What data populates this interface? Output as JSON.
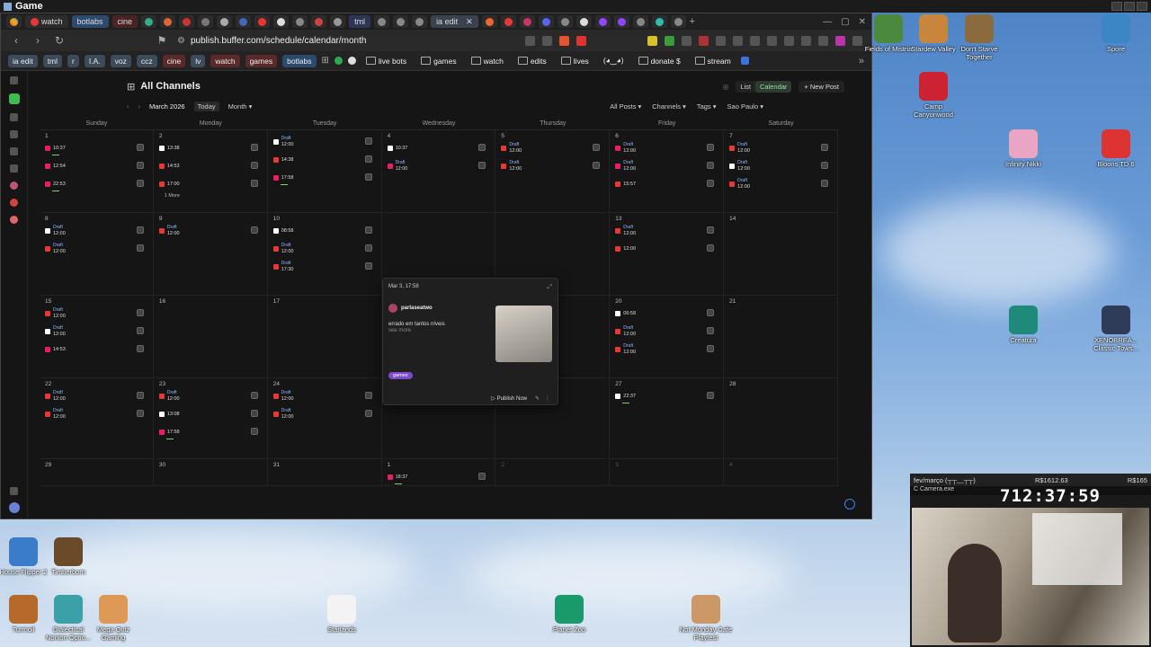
{
  "os": {
    "window_title": "Game"
  },
  "browser": {
    "tabs": [
      {
        "label": "",
        "color": "#e53935"
      },
      {
        "label": "watch",
        "color": "#e53935"
      },
      {
        "label": "botlabs",
        "color": "#2b7bd8"
      },
      {
        "label": "cine",
        "color": "#e53935"
      },
      {
        "label": "tml",
        "color": "#4c5bd4"
      },
      {
        "label": "ia edit",
        "color": "#888",
        "active": true
      }
    ],
    "url": "publish.buffer.com/schedule/calendar/month",
    "bookmarks": [
      {
        "label": "ia edit",
        "kind": "pill"
      },
      {
        "label": "tml",
        "kind": "pill"
      },
      {
        "label": "r",
        "kind": "pill"
      },
      {
        "label": "I.A.",
        "kind": "pill"
      },
      {
        "label": "voz",
        "kind": "pill"
      },
      {
        "label": "ccz",
        "kind": "pill"
      },
      {
        "label": "cine",
        "kind": "pill"
      },
      {
        "label": "lv",
        "kind": "pill"
      },
      {
        "label": "watch",
        "kind": "pill"
      },
      {
        "label": "games",
        "kind": "pill"
      },
      {
        "label": "botlabs",
        "kind": "pill"
      },
      {
        "label": "live bots",
        "kind": "folder"
      },
      {
        "label": "games",
        "kind": "folder"
      },
      {
        "label": "watch",
        "kind": "folder"
      },
      {
        "label": "edits",
        "kind": "folder"
      },
      {
        "label": "lives",
        "kind": "folder"
      },
      {
        "label": "(◕‿◕)",
        "kind": "plain"
      },
      {
        "label": "donate $",
        "kind": "folder"
      },
      {
        "label": "stream",
        "kind": "folder"
      }
    ]
  },
  "calendar": {
    "title": "All Channels",
    "month_label": "March 2026",
    "today_label": "Today",
    "view_label": "Month",
    "list_label": "List",
    "calendar_label": "Calendar",
    "new_post_label": "New Post",
    "filters": [
      "All Posts",
      "Channels",
      "Tags",
      "Sao Paulo"
    ],
    "weekdays": [
      "Sunday",
      "Monday",
      "Tuesday",
      "Wednesday",
      "Thursday",
      "Friday",
      "Saturday"
    ],
    "days": [
      {
        "n": "1",
        "posts": [
          {
            "t": "10:37",
            "c": "#e91e63",
            "bar": true
          },
          {
            "t": "12:54",
            "c": "#e91e63"
          },
          {
            "t": "22:53",
            "c": "#e91e63",
            "bar": true
          }
        ]
      },
      {
        "n": "2",
        "posts": [
          {
            "t": "13:38",
            "c": "#fff"
          },
          {
            "t": "14:53",
            "c": "#e53935"
          },
          {
            "t": "17:00",
            "c": "#e53935"
          }
        ],
        "more": "1 More"
      },
      {
        "n": "",
        "posts": [
          {
            "t": "12:00",
            "c": "#fff",
            "draft": true
          },
          {
            "t": "14:38",
            "c": "#e53935"
          },
          {
            "t": "17:58",
            "c": "#e91e63",
            "bar": true
          }
        ]
      },
      {
        "n": "4",
        "posts": [
          {
            "t": "10:37",
            "c": "#fff"
          },
          {
            "t": "12:00",
            "c": "#e91e63",
            "draft": true
          }
        ]
      },
      {
        "n": "5",
        "posts": [
          {
            "t": "12:00",
            "c": "#e53935",
            "draft": true
          },
          {
            "t": "12:00",
            "c": "#e53935",
            "draft": true
          }
        ]
      },
      {
        "n": "6",
        "posts": [
          {
            "t": "12:00",
            "c": "#e91e63",
            "draft": true
          },
          {
            "t": "12:00",
            "c": "#e91e63",
            "draft": true
          },
          {
            "t": "15:57",
            "c": "#e53935"
          }
        ]
      },
      {
        "n": "7",
        "posts": [
          {
            "t": "12:00",
            "c": "#e53935",
            "draft": true
          },
          {
            "t": "12:00",
            "c": "#fff",
            "draft": true
          },
          {
            "t": "12:00",
            "c": "#e53935",
            "draft": true
          }
        ]
      },
      {
        "n": "8",
        "posts": [
          {
            "t": "12:00",
            "c": "#fff",
            "draft": true
          },
          {
            "t": "12:00",
            "c": "#e53935",
            "draft": true
          }
        ]
      },
      {
        "n": "9",
        "posts": [
          {
            "t": "12:00",
            "c": "#e53935",
            "draft": true
          }
        ]
      },
      {
        "n": "10",
        "posts": [
          {
            "t": "08:58",
            "c": "#fff"
          },
          {
            "t": "12:00",
            "c": "#e53935",
            "draft": true
          },
          {
            "t": "17:30",
            "c": "#e53935",
            "draft": true
          }
        ]
      },
      {
        "n": "",
        "posts": []
      },
      {
        "n": "",
        "posts": []
      },
      {
        "n": "13",
        "posts": [
          {
            "t": "12:00",
            "c": "#e53935",
            "draft": true
          },
          {
            "t": "12:00",
            "c": "#e53935"
          }
        ]
      },
      {
        "n": "14",
        "posts": []
      },
      {
        "n": "15",
        "posts": [
          {
            "t": "12:00",
            "c": "#e53935",
            "draft": true
          },
          {
            "t": "12:00",
            "c": "#fff",
            "draft": true
          },
          {
            "t": "14:53",
            "c": "#e91e63"
          }
        ]
      },
      {
        "n": "16",
        "posts": []
      },
      {
        "n": "17",
        "posts": []
      },
      {
        "n": "",
        "posts": []
      },
      {
        "n": "",
        "posts": []
      },
      {
        "n": "20",
        "posts": [
          {
            "t": "06:58",
            "c": "#fff"
          },
          {
            "t": "12:00",
            "c": "#e53935",
            "draft": true
          },
          {
            "t": "12:00",
            "c": "#e53935",
            "draft": true
          }
        ]
      },
      {
        "n": "21",
        "posts": []
      },
      {
        "n": "22",
        "posts": [
          {
            "t": "12:00",
            "c": "#e53935",
            "draft": true
          },
          {
            "t": "12:00",
            "c": "#e53935",
            "draft": true
          }
        ]
      },
      {
        "n": "23",
        "posts": [
          {
            "t": "12:00",
            "c": "#e53935",
            "draft": true
          },
          {
            "t": "13:08",
            "c": "#fff"
          },
          {
            "t": "17:58",
            "c": "#e91e63",
            "bar": true
          }
        ]
      },
      {
        "n": "24",
        "posts": [
          {
            "t": "12:00",
            "c": "#e53935",
            "draft": true
          },
          {
            "t": "12:00",
            "c": "#e53935",
            "draft": true
          }
        ]
      },
      {
        "n": "25",
        "posts": [
          {
            "t": "12:00",
            "c": "#e91e63",
            "draft": true
          }
        ]
      },
      {
        "n": "26",
        "posts": []
      },
      {
        "n": "27",
        "posts": [
          {
            "t": "22:37",
            "c": "#fff",
            "bar": true
          }
        ]
      },
      {
        "n": "28",
        "posts": []
      },
      {
        "n": "29",
        "posts": []
      },
      {
        "n": "30",
        "posts": []
      },
      {
        "n": "31",
        "posts": []
      },
      {
        "n": "1",
        "posts": [
          {
            "t": "18:37",
            "c": "#e91e63",
            "bar": true
          }
        ]
      },
      {
        "n": "2",
        "dim": true,
        "posts": []
      },
      {
        "n": "3",
        "dim": true,
        "posts": []
      },
      {
        "n": "4",
        "dim": true,
        "posts": []
      }
    ],
    "popover": {
      "datetime": "Mar 3, 17:58",
      "account": "parlaseatwo",
      "text": "errado em tantos níveis",
      "see_more": "see more",
      "tag": "games",
      "publish_label": "Publish Now"
    }
  },
  "desktop": {
    "icons": [
      {
        "label": "Fields of Mistria",
        "color": "#4b8a3e"
      },
      {
        "label": "Stardew Valley",
        "color": "#c8863d"
      },
      {
        "label": "Don't Starve Together",
        "color": "#8b6b3e"
      },
      {
        "label": "Spore",
        "color": "#3d86c6"
      },
      {
        "label": "Camp Canyonwood",
        "color": "#c23"
      },
      {
        "label": "Infinity Nikki",
        "color": "#e8a6c4"
      },
      {
        "label": "Bloons TD 6",
        "color": "#d33"
      },
      {
        "label": "Creatura",
        "color": "#1f8a7a"
      },
      {
        "label": "XENOBREA... Classic Tows...",
        "color": "#2e3c5a"
      },
      {
        "label": "House Flipper 2",
        "color": "#3a7cc8"
      },
      {
        "label": "Timberborn",
        "color": "#6b4a2a"
      },
      {
        "label": "Turmoil",
        "color": "#b56a2c"
      },
      {
        "label": "Dialectical Nonion Optio...",
        "color": "#3ba0a8"
      },
      {
        "label": "Mega Quiz Gaming",
        "color": "#d95"
      },
      {
        "label": "Starlands",
        "color": "#f3f3f3"
      },
      {
        "label": "Planet Zoo",
        "color": "#1a9a6a"
      },
      {
        "label": "Not Monday Cafe Playtest",
        "color": "#c96"
      }
    ]
  },
  "stream": {
    "goal_label": "fev/março (┬┬﹏┬┬)",
    "amount": "R$1612.63",
    "amount_right": "R$165",
    "cam_title": "C Camera.exe",
    "timer": "712:37:59"
  }
}
